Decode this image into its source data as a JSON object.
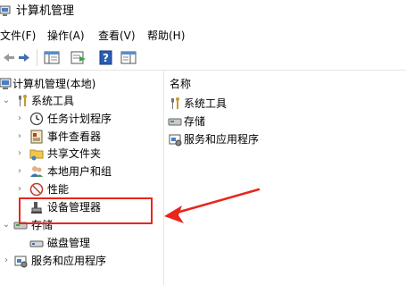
{
  "window": {
    "title": "计算机管理"
  },
  "menu": {
    "file": "文件(F)",
    "action": "操作(A)",
    "view": "查看(V)",
    "help": "帮助(H)"
  },
  "tree": {
    "root": "计算机管理(本地)",
    "system_tools": "系统工具",
    "task_scheduler": "任务计划程序",
    "event_viewer": "事件查看器",
    "shared_folders": "共享文件夹",
    "local_users": "本地用户和组",
    "performance": "性能",
    "device_manager": "设备管理器",
    "storage": "存储",
    "disk_management": "磁盘管理",
    "services_apps": "服务和应用程序"
  },
  "right": {
    "header": "名称",
    "items": [
      "系统工具",
      "存储",
      "服务和应用程序"
    ]
  },
  "colors": {
    "highlight": "#e8261b"
  }
}
